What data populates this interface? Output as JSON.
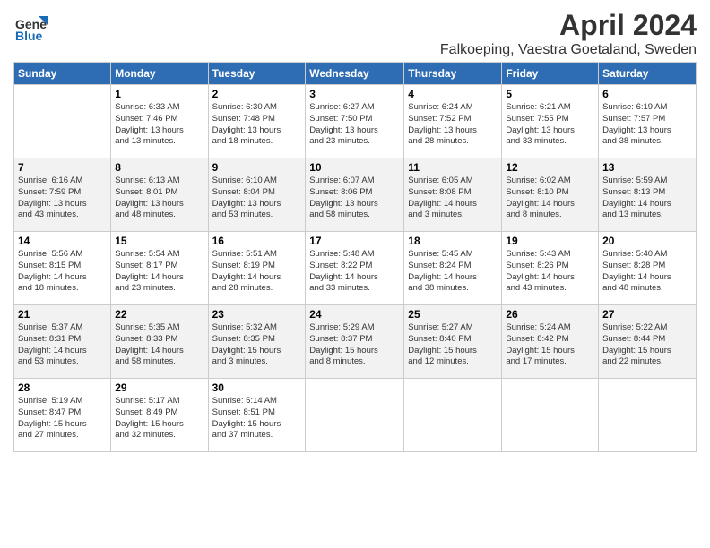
{
  "logo": {
    "general": "General",
    "blue": "Blue"
  },
  "title": "April 2024",
  "location": "Falkoeping, Vaestra Goetaland, Sweden",
  "days_header": [
    "Sunday",
    "Monday",
    "Tuesday",
    "Wednesday",
    "Thursday",
    "Friday",
    "Saturday"
  ],
  "weeks": [
    [
      {
        "num": "",
        "info": ""
      },
      {
        "num": "1",
        "info": "Sunrise: 6:33 AM\nSunset: 7:46 PM\nDaylight: 13 hours\nand 13 minutes."
      },
      {
        "num": "2",
        "info": "Sunrise: 6:30 AM\nSunset: 7:48 PM\nDaylight: 13 hours\nand 18 minutes."
      },
      {
        "num": "3",
        "info": "Sunrise: 6:27 AM\nSunset: 7:50 PM\nDaylight: 13 hours\nand 23 minutes."
      },
      {
        "num": "4",
        "info": "Sunrise: 6:24 AM\nSunset: 7:52 PM\nDaylight: 13 hours\nand 28 minutes."
      },
      {
        "num": "5",
        "info": "Sunrise: 6:21 AM\nSunset: 7:55 PM\nDaylight: 13 hours\nand 33 minutes."
      },
      {
        "num": "6",
        "info": "Sunrise: 6:19 AM\nSunset: 7:57 PM\nDaylight: 13 hours\nand 38 minutes."
      }
    ],
    [
      {
        "num": "7",
        "info": "Sunrise: 6:16 AM\nSunset: 7:59 PM\nDaylight: 13 hours\nand 43 minutes."
      },
      {
        "num": "8",
        "info": "Sunrise: 6:13 AM\nSunset: 8:01 PM\nDaylight: 13 hours\nand 48 minutes."
      },
      {
        "num": "9",
        "info": "Sunrise: 6:10 AM\nSunset: 8:04 PM\nDaylight: 13 hours\nand 53 minutes."
      },
      {
        "num": "10",
        "info": "Sunrise: 6:07 AM\nSunset: 8:06 PM\nDaylight: 13 hours\nand 58 minutes."
      },
      {
        "num": "11",
        "info": "Sunrise: 6:05 AM\nSunset: 8:08 PM\nDaylight: 14 hours\nand 3 minutes."
      },
      {
        "num": "12",
        "info": "Sunrise: 6:02 AM\nSunset: 8:10 PM\nDaylight: 14 hours\nand 8 minutes."
      },
      {
        "num": "13",
        "info": "Sunrise: 5:59 AM\nSunset: 8:13 PM\nDaylight: 14 hours\nand 13 minutes."
      }
    ],
    [
      {
        "num": "14",
        "info": "Sunrise: 5:56 AM\nSunset: 8:15 PM\nDaylight: 14 hours\nand 18 minutes."
      },
      {
        "num": "15",
        "info": "Sunrise: 5:54 AM\nSunset: 8:17 PM\nDaylight: 14 hours\nand 23 minutes."
      },
      {
        "num": "16",
        "info": "Sunrise: 5:51 AM\nSunset: 8:19 PM\nDaylight: 14 hours\nand 28 minutes."
      },
      {
        "num": "17",
        "info": "Sunrise: 5:48 AM\nSunset: 8:22 PM\nDaylight: 14 hours\nand 33 minutes."
      },
      {
        "num": "18",
        "info": "Sunrise: 5:45 AM\nSunset: 8:24 PM\nDaylight: 14 hours\nand 38 minutes."
      },
      {
        "num": "19",
        "info": "Sunrise: 5:43 AM\nSunset: 8:26 PM\nDaylight: 14 hours\nand 43 minutes."
      },
      {
        "num": "20",
        "info": "Sunrise: 5:40 AM\nSunset: 8:28 PM\nDaylight: 14 hours\nand 48 minutes."
      }
    ],
    [
      {
        "num": "21",
        "info": "Sunrise: 5:37 AM\nSunset: 8:31 PM\nDaylight: 14 hours\nand 53 minutes."
      },
      {
        "num": "22",
        "info": "Sunrise: 5:35 AM\nSunset: 8:33 PM\nDaylight: 14 hours\nand 58 minutes."
      },
      {
        "num": "23",
        "info": "Sunrise: 5:32 AM\nSunset: 8:35 PM\nDaylight: 15 hours\nand 3 minutes."
      },
      {
        "num": "24",
        "info": "Sunrise: 5:29 AM\nSunset: 8:37 PM\nDaylight: 15 hours\nand 8 minutes."
      },
      {
        "num": "25",
        "info": "Sunrise: 5:27 AM\nSunset: 8:40 PM\nDaylight: 15 hours\nand 12 minutes."
      },
      {
        "num": "26",
        "info": "Sunrise: 5:24 AM\nSunset: 8:42 PM\nDaylight: 15 hours\nand 17 minutes."
      },
      {
        "num": "27",
        "info": "Sunrise: 5:22 AM\nSunset: 8:44 PM\nDaylight: 15 hours\nand 22 minutes."
      }
    ],
    [
      {
        "num": "28",
        "info": "Sunrise: 5:19 AM\nSunset: 8:47 PM\nDaylight: 15 hours\nand 27 minutes."
      },
      {
        "num": "29",
        "info": "Sunrise: 5:17 AM\nSunset: 8:49 PM\nDaylight: 15 hours\nand 32 minutes."
      },
      {
        "num": "30",
        "info": "Sunrise: 5:14 AM\nSunset: 8:51 PM\nDaylight: 15 hours\nand 37 minutes."
      },
      {
        "num": "",
        "info": ""
      },
      {
        "num": "",
        "info": ""
      },
      {
        "num": "",
        "info": ""
      },
      {
        "num": "",
        "info": ""
      }
    ]
  ]
}
